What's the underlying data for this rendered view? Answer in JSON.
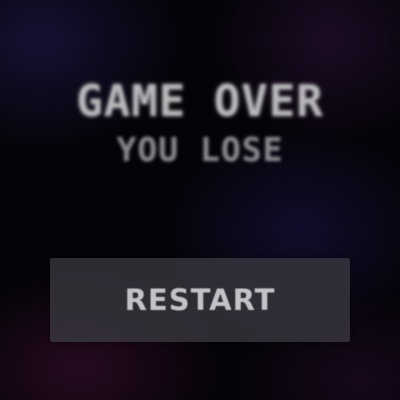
{
  "game_over": {
    "title": "GAME OVER",
    "subtitle": "YOU LOSE",
    "restart_label": "RESTART"
  },
  "colors": {
    "background": "#07050b",
    "title_text": "#b9b9bc",
    "subtitle_text": "#8f8f93",
    "button_background": "#3a3840",
    "button_text": "#c4c4c7"
  }
}
